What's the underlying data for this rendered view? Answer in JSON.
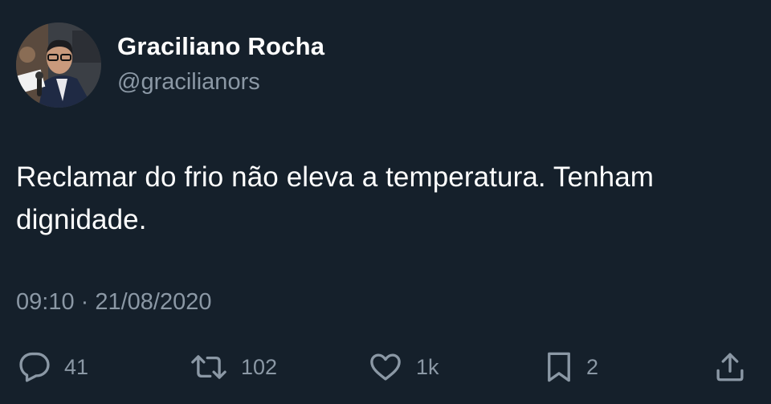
{
  "user": {
    "display_name": "Graciliano Rocha",
    "handle": "@gracilianors",
    "avatar_icon": "profile-photo"
  },
  "tweet": {
    "text": "Reclamar do frio não eleva a temperatura. Tenham dignidade.",
    "timestamp": "09:10 · 21/08/2020"
  },
  "actions": {
    "reply": {
      "icon": "reply-icon",
      "count": "41"
    },
    "retweet": {
      "icon": "retweet-icon",
      "count": "102"
    },
    "like": {
      "icon": "heart-icon",
      "count": "1k"
    },
    "bookmark": {
      "icon": "bookmark-icon",
      "count": "2"
    },
    "share": {
      "icon": "share-icon"
    }
  },
  "colors": {
    "background": "#15202b",
    "primary_text": "#ffffff",
    "secondary_text": "#8b98a5"
  }
}
